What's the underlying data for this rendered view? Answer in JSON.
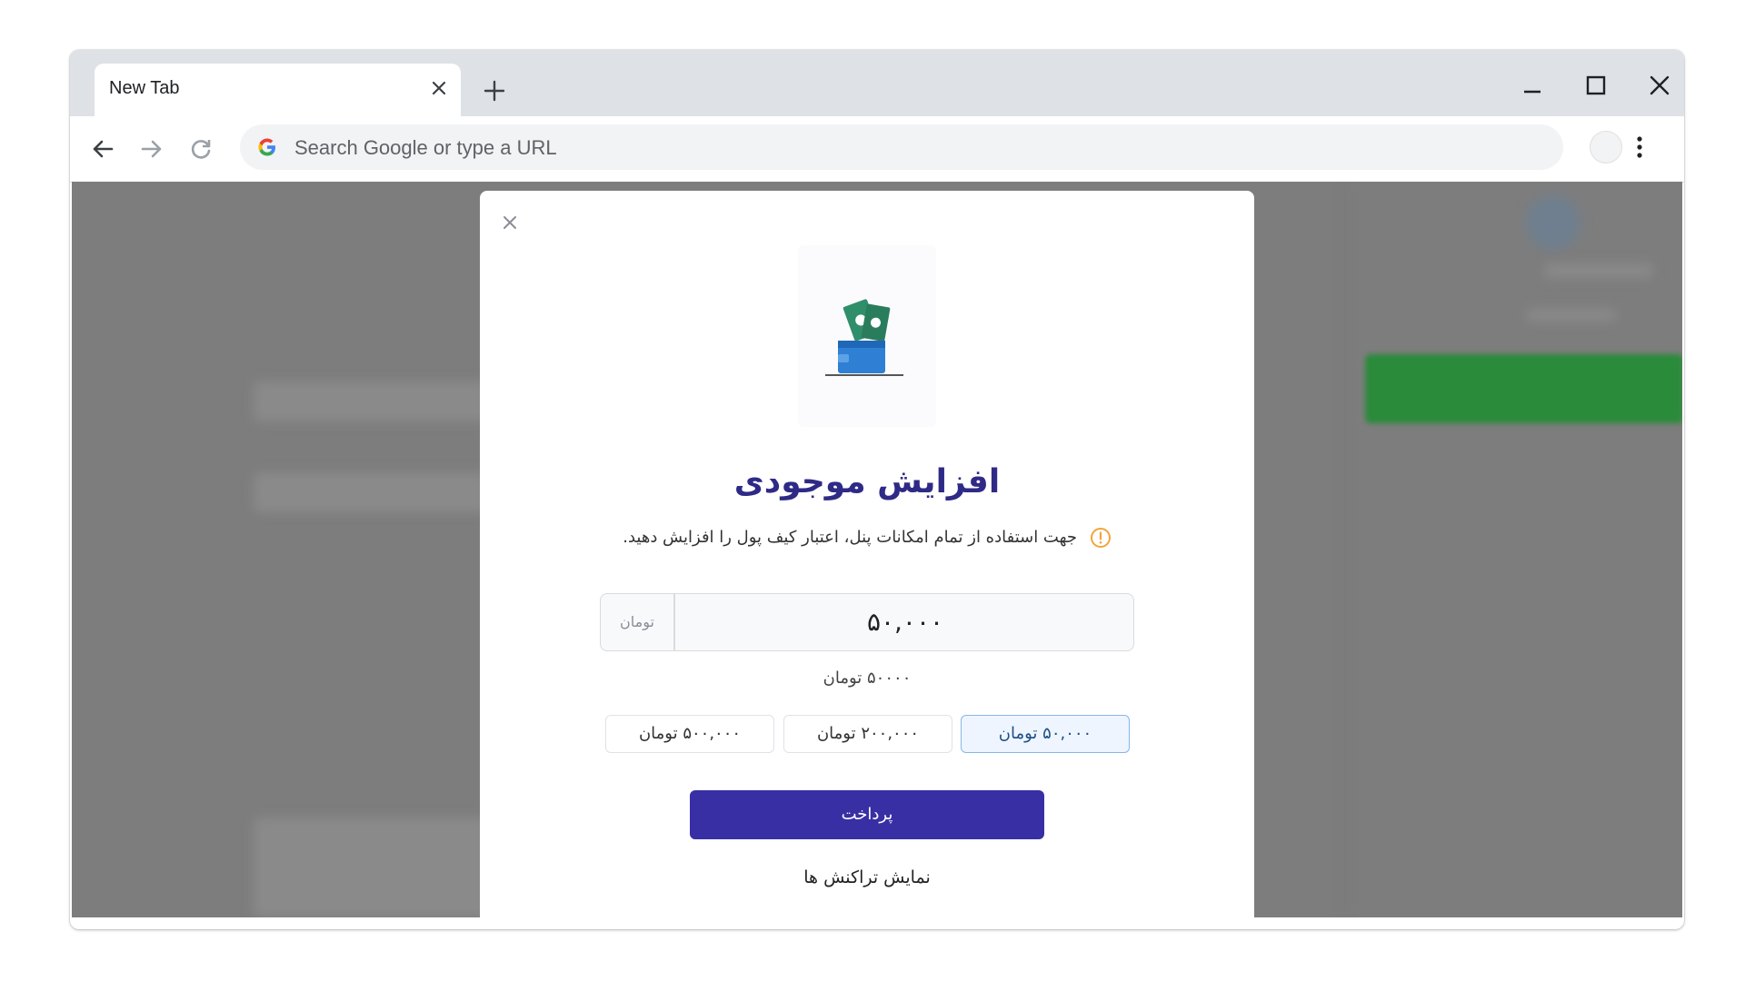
{
  "browser": {
    "tab_title": "New Tab",
    "omnibox_placeholder": "Search Google or type a URL"
  },
  "modal": {
    "title": "افزایش موجودی",
    "notice": "جهت استفاده از تمام امکانات پنل، اعتبار کیف پول را افزایش دهید.",
    "amount_unit": "تومان",
    "amount_value": "۵۰,۰۰۰",
    "amount_words": "۵۰۰۰۰ تومان",
    "presets": [
      "۵۰,۰۰۰ تومان",
      "۲۰۰,۰۰۰ تومان",
      "۵۰۰,۰۰۰ تومان"
    ],
    "selected_preset": 0,
    "pay_label": "پرداخت",
    "transactions_link": "نمایش تراکنش ها"
  },
  "colors": {
    "primary": "#382fa4",
    "title": "#2e2a86",
    "warning": "#f0a53a",
    "overlay": "#7d7d7d"
  },
  "icons": [
    "close-icon",
    "plus-icon",
    "minimize-icon",
    "maximize-icon",
    "back-icon",
    "forward-icon",
    "reload-icon",
    "google-icon",
    "menu-dots-icon",
    "wallet-icon",
    "info-icon"
  ]
}
